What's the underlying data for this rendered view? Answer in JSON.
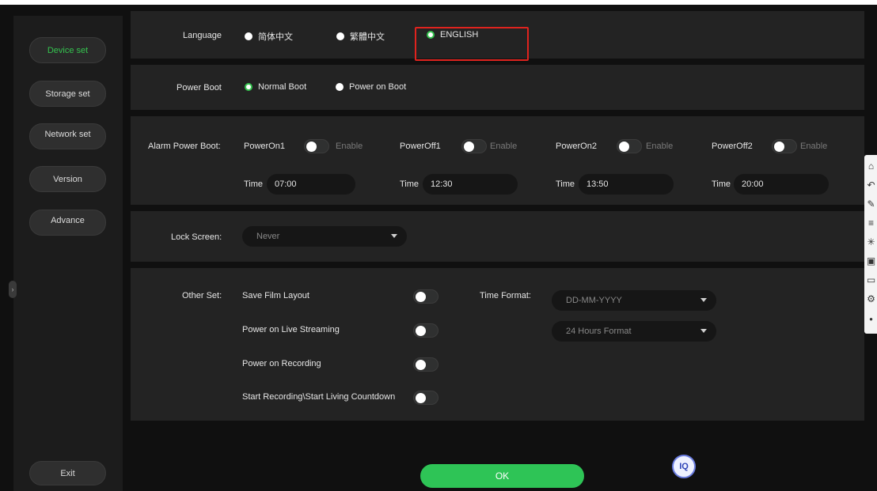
{
  "sidebar": {
    "items": [
      {
        "label": "Device set",
        "active": true
      },
      {
        "label": "Storage set"
      },
      {
        "label": "Network set"
      },
      {
        "label": "Version"
      },
      {
        "label": "Advance"
      }
    ],
    "exit_label": "Exit"
  },
  "language": {
    "label": "Language",
    "options": [
      "简体中文",
      "繁體中文",
      "ENGLISH"
    ],
    "selected": "ENGLISH"
  },
  "power_boot": {
    "label": "Power Boot",
    "options": [
      "Normal Boot",
      "Power on Boot"
    ],
    "selected": "Normal Boot"
  },
  "alarm_power_boot": {
    "label": "Alarm Power Boot:",
    "enable_label": "Enable",
    "time_label": "Time",
    "entries": [
      {
        "name": "PowerOn1",
        "time": "07:00",
        "enabled": false
      },
      {
        "name": "PowerOff1",
        "time": "12:30",
        "enabled": false
      },
      {
        "name": "PowerOn2",
        "time": "13:50",
        "enabled": false
      },
      {
        "name": "PowerOff2",
        "time": "20:00",
        "enabled": false
      }
    ]
  },
  "lock_screen": {
    "label": "Lock Screen:",
    "value": "Never"
  },
  "other_set": {
    "label": "Other Set:",
    "toggles": [
      {
        "label": "Save Film Layout",
        "enabled": false
      },
      {
        "label": "Power on Live Streaming",
        "enabled": false
      },
      {
        "label": "Power on Recording",
        "enabled": false
      },
      {
        "label": "Start Recording\\Start Living Countdown",
        "enabled": false
      }
    ],
    "time_format_label": "Time Format:",
    "date_format": "DD-MM-YYYY",
    "hour_format": "24 Hours Format"
  },
  "ok_label": "OK",
  "badge_label": "IQ",
  "colors": {
    "accent": "#35c34f",
    "highlight": "#e0231e",
    "background": "#101010",
    "panel": "#232323"
  },
  "toolbar_icons": [
    "home-icon",
    "back-icon",
    "edit-icon",
    "list-icon",
    "snowflake-icon",
    "save-icon",
    "monitor-icon",
    "settings-icon"
  ]
}
